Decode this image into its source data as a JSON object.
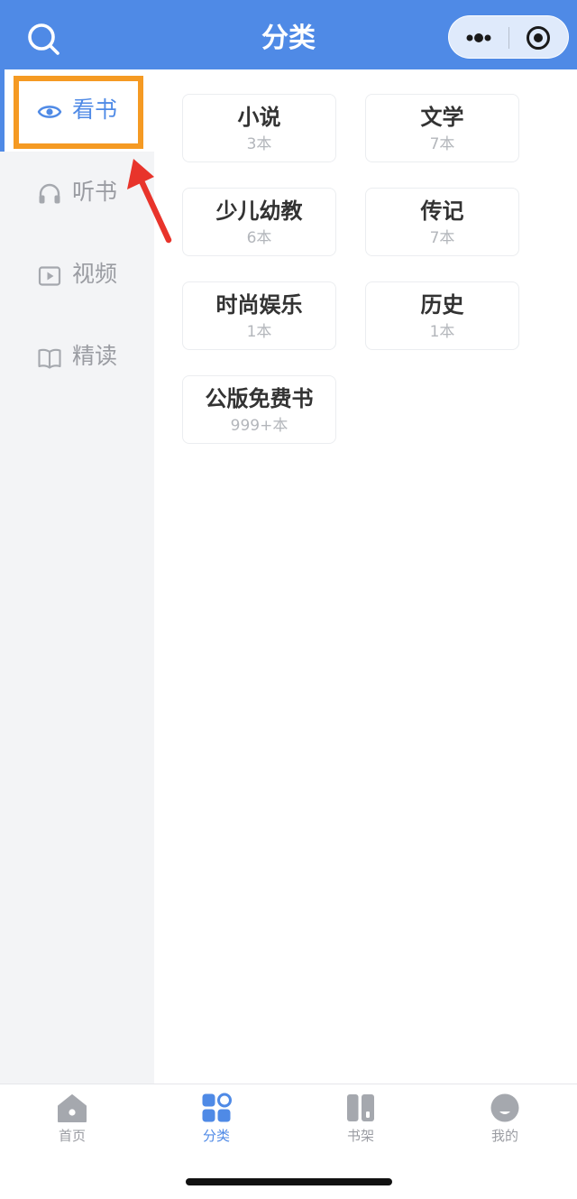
{
  "header": {
    "title": "分类",
    "search_icon": "search-icon",
    "more_icon": "more-dots-icon",
    "close_icon": "target-close-icon",
    "accent": "#4f8ae6"
  },
  "sidebar": {
    "items": [
      {
        "label": "看书",
        "icon": "eye-icon",
        "active": true
      },
      {
        "label": "听书",
        "icon": "headphones-icon",
        "active": false
      },
      {
        "label": "视频",
        "icon": "video-play-icon",
        "active": false
      },
      {
        "label": "精读",
        "icon": "open-book-icon",
        "active": false
      }
    ]
  },
  "categories": [
    {
      "name": "小说",
      "count": "3本"
    },
    {
      "name": "文学",
      "count": "7本"
    },
    {
      "name": "少儿幼教",
      "count": "6本"
    },
    {
      "name": "传记",
      "count": "7本"
    },
    {
      "name": "时尚娱乐",
      "count": "1本"
    },
    {
      "name": "历史",
      "count": "1本"
    },
    {
      "name": "公版免费书",
      "count": "999+本"
    }
  ],
  "tabbar": {
    "tabs": [
      {
        "label": "首页",
        "icon": "home-icon",
        "active": false
      },
      {
        "label": "分类",
        "icon": "category-grid-icon",
        "active": true
      },
      {
        "label": "书架",
        "icon": "bookshelf-icon",
        "active": false
      },
      {
        "label": "我的",
        "icon": "profile-face-icon",
        "active": false
      }
    ]
  },
  "annotation": {
    "highlight_color": "#f59a23",
    "arrow_color": "#e8342b"
  }
}
